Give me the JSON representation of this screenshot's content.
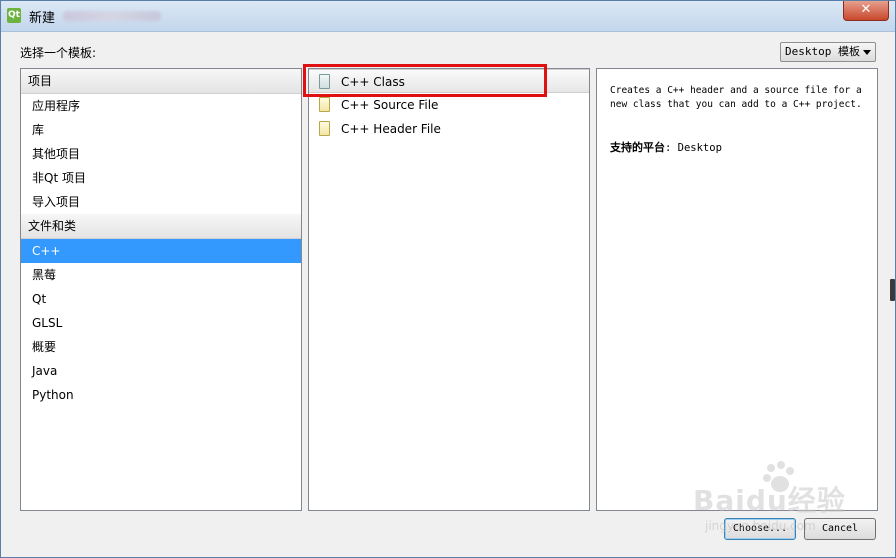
{
  "window": {
    "title": "新建",
    "close_label": "✕"
  },
  "header": {
    "choose_template_label": "选择一个模板:",
    "filter_value": "Desktop 模板"
  },
  "categories": {
    "projects_header": "项目",
    "project_items": [
      "应用程序",
      "库",
      "其他项目",
      "非Qt 项目",
      "导入项目"
    ],
    "files_header": "文件和类",
    "file_items": [
      "C++",
      "黑莓",
      "Qt",
      "GLSL",
      "概要",
      "Java",
      "Python"
    ],
    "selected": "C++"
  },
  "templates": {
    "items": [
      {
        "label": "C++ Class",
        "icon": "class-file-icon",
        "selected": true
      },
      {
        "label": "C++ Source File",
        "icon": "source-file-icon",
        "selected": false
      },
      {
        "label": "C++ Header File",
        "icon": "header-file-icon",
        "selected": false
      }
    ]
  },
  "description": {
    "text": "Creates a C++ header and a source file for a new class that you can add to a C++ project.",
    "platform_label": "支持的平台",
    "platform_value": ": Desktop"
  },
  "buttons": {
    "choose": "Choose...",
    "cancel": "Cancel"
  },
  "watermark": {
    "text": "Baidu经验",
    "sub": "jingyan.baidu.com"
  },
  "colors": {
    "selection": "#3399ff",
    "highlight_box": "#e01010"
  }
}
